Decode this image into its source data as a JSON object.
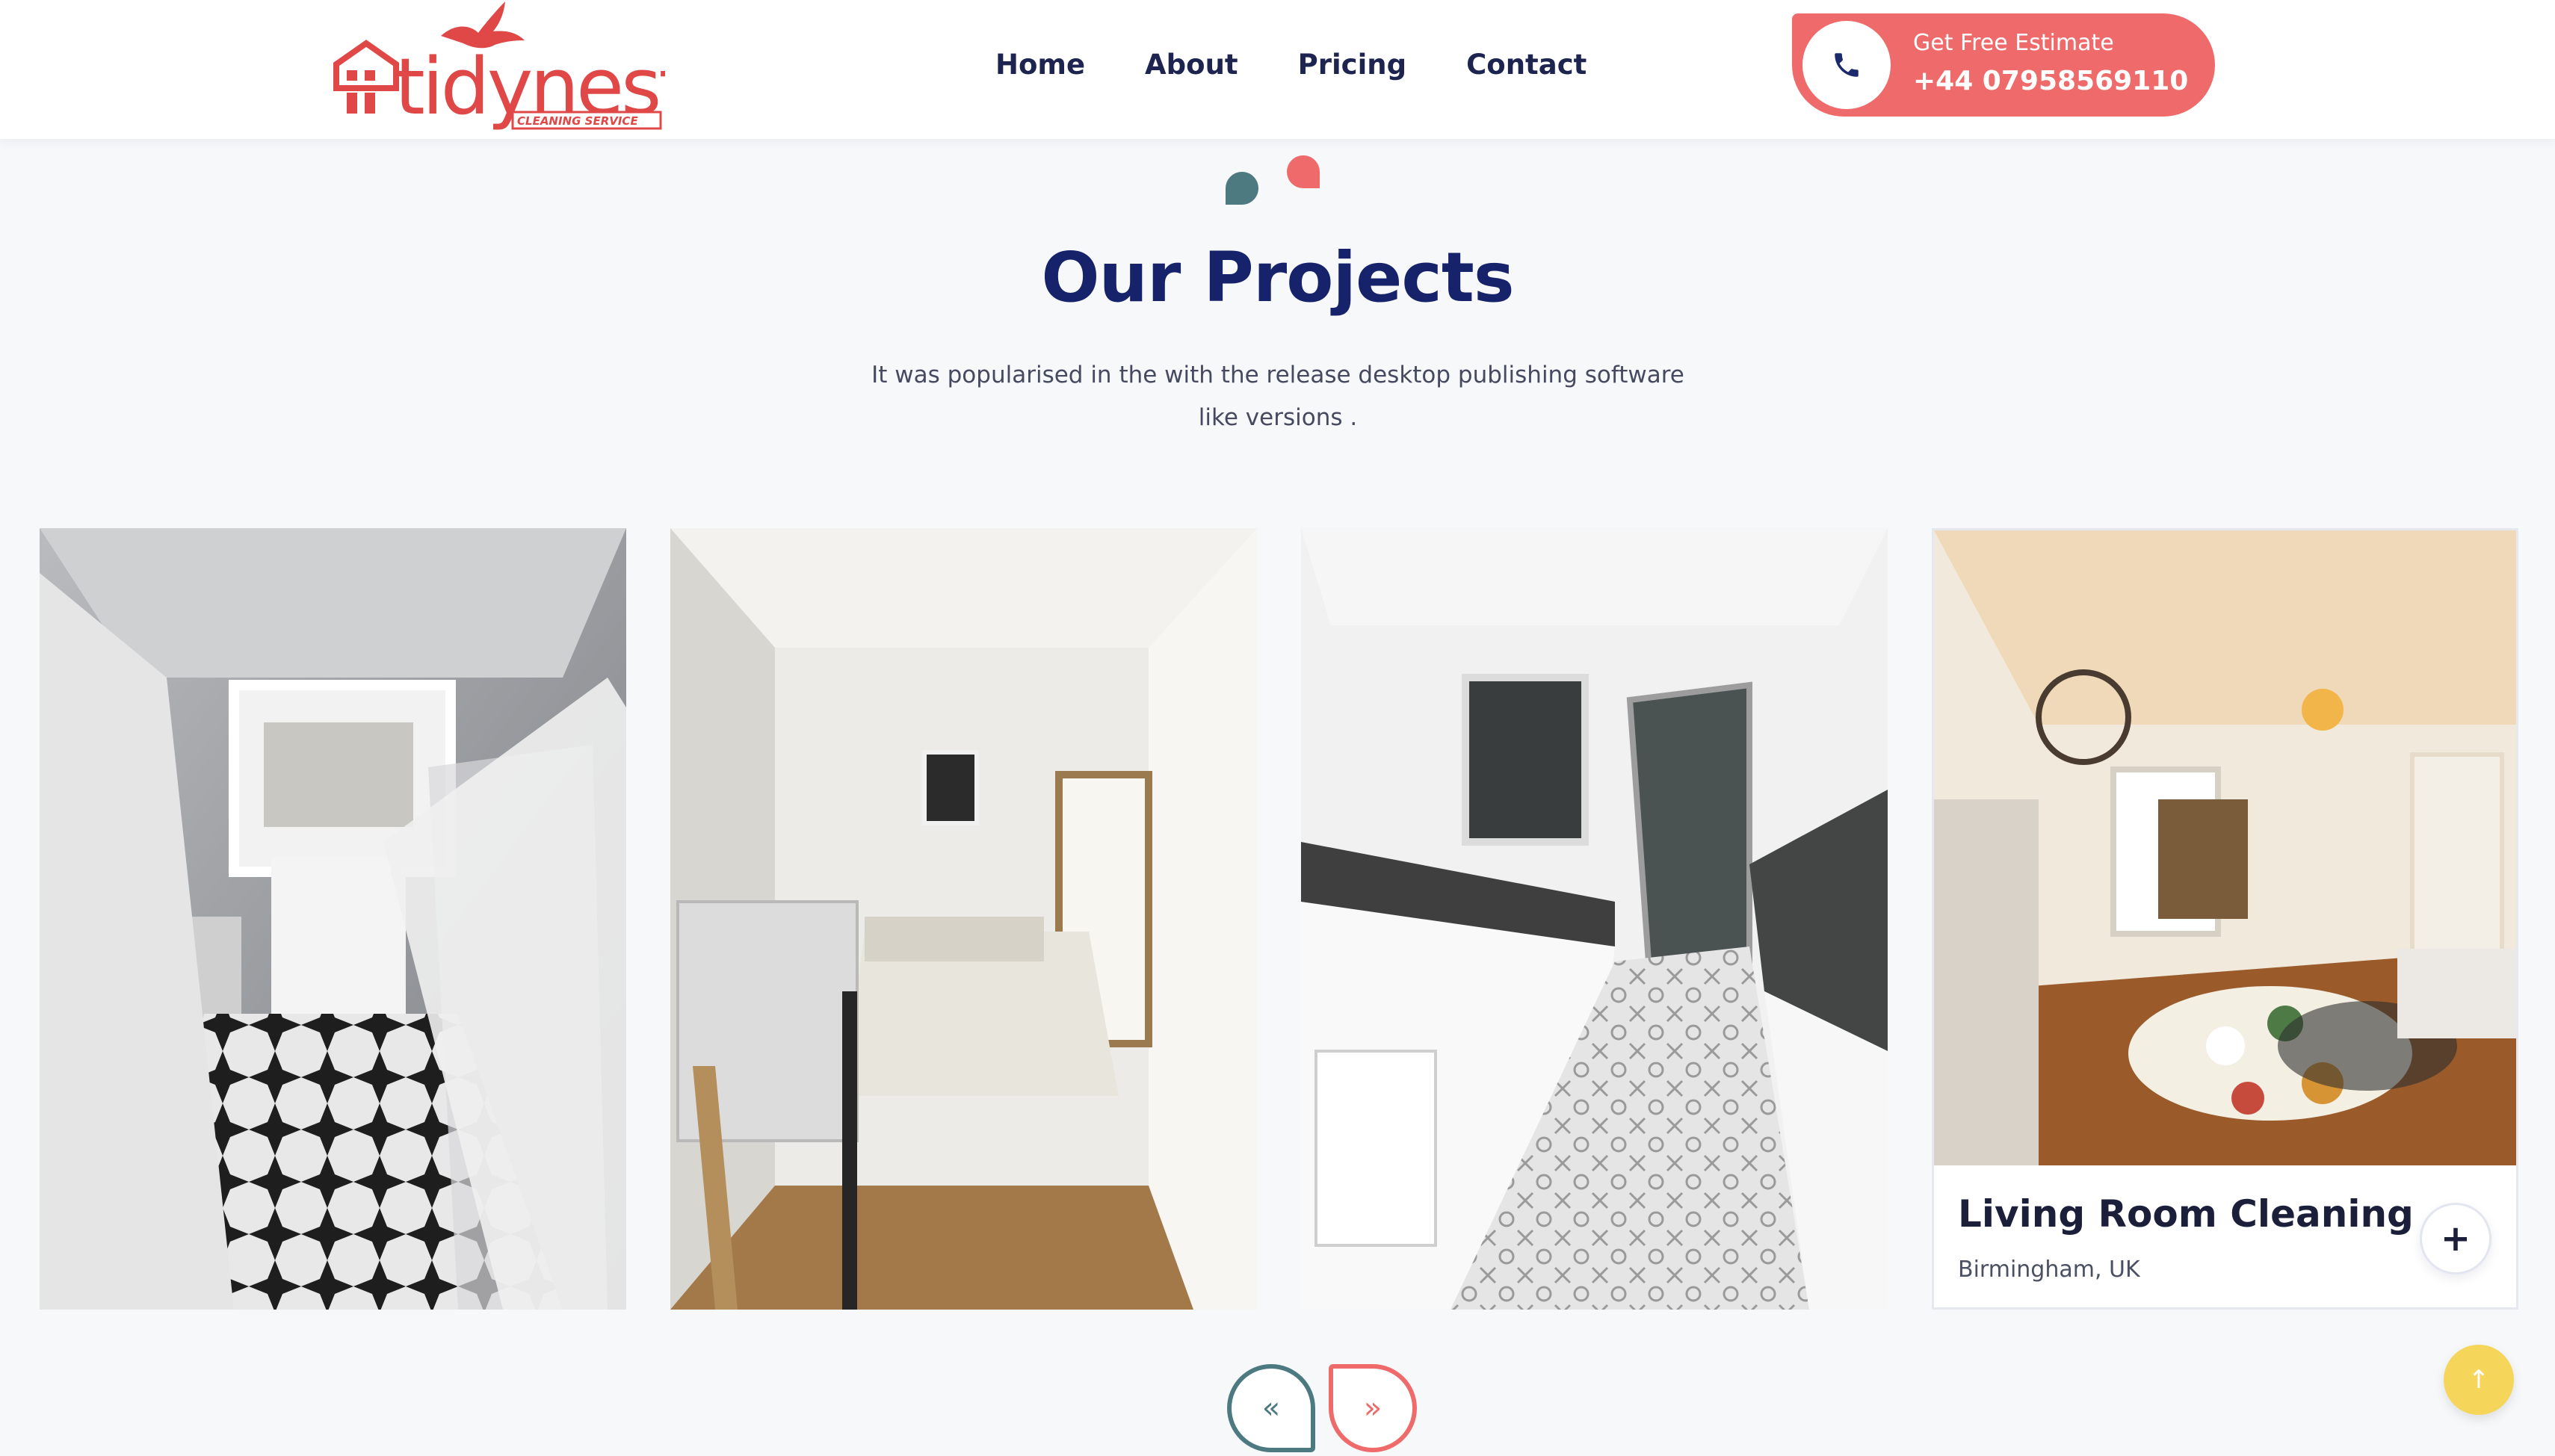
{
  "brand": {
    "logo_text": "tidynest",
    "logo_tagline": "CLEANING SERVICE",
    "primary_color": "#ef6a6a",
    "secondary_color": "#4d7a80",
    "heading_color": "#16236b"
  },
  "nav": {
    "items": [
      {
        "label": "Home"
      },
      {
        "label": "About"
      },
      {
        "label": "Pricing"
      },
      {
        "label": "Contact"
      }
    ]
  },
  "cta": {
    "label": "Get Free Estimate",
    "phone": "+44 07958569110",
    "icon": "phone-icon"
  },
  "section": {
    "title": "Our Projects",
    "subtitle": "It was popularised in the with the release desktop publishing software like versions ."
  },
  "projects": [
    {
      "image": "bathroom-photo"
    },
    {
      "image": "bedroom-photo"
    },
    {
      "image": "kitchen-photo"
    },
    {
      "image": "living-room-photo",
      "title": "Living Room Cleaning",
      "location": "Birmingham, UK",
      "action_icon": "plus-icon"
    }
  ],
  "slider": {
    "prev_icon": "«",
    "next_icon": "»"
  },
  "back_to_top": {
    "icon": "↑"
  }
}
